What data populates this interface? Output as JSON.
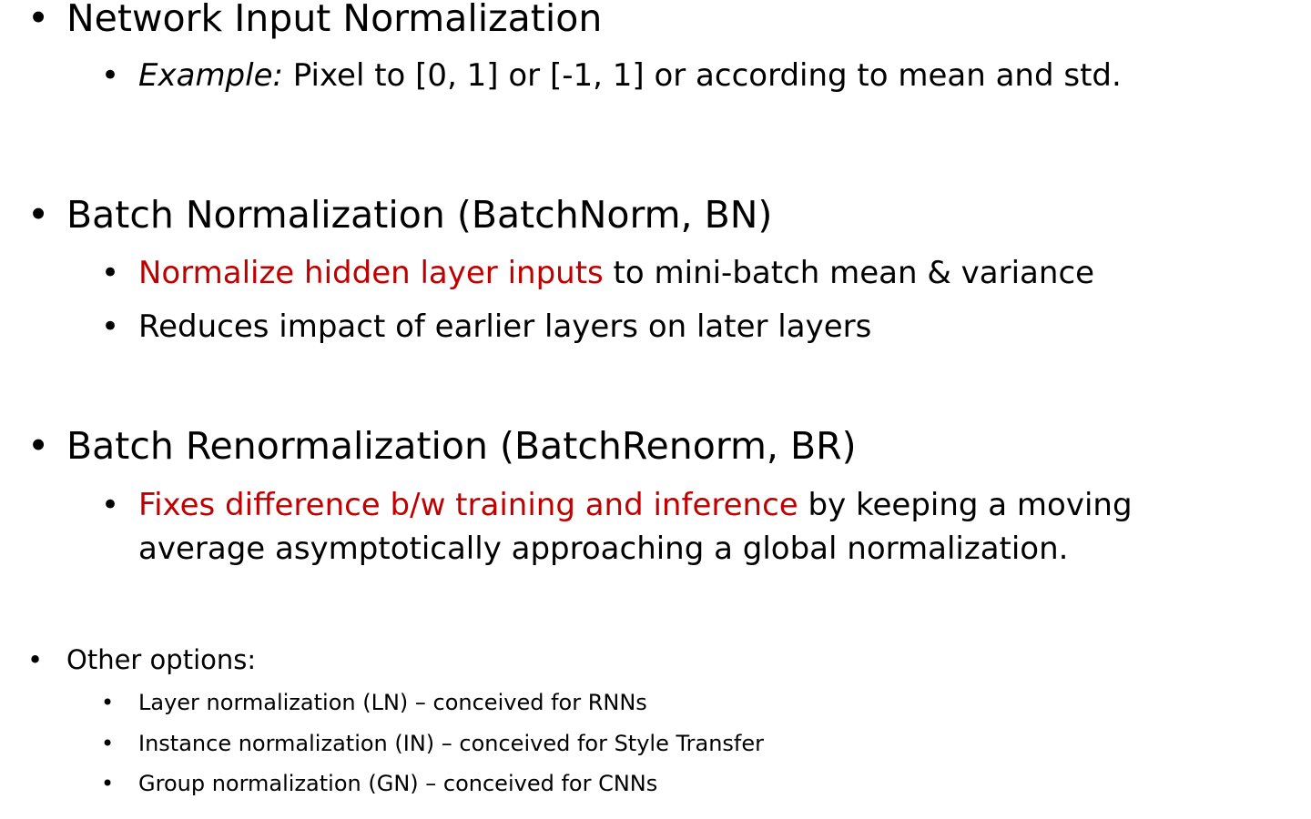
{
  "bullet_glyph": "•",
  "colors": {
    "text": "#000000",
    "highlight": "#c00000",
    "background": "#ffffff"
  },
  "section1": {
    "heading": "Network Input Normalization",
    "sub": [
      {
        "em": "Example:",
        "rest": " Pixel to [0, 1] or [-1, 1] or according to mean and std."
      }
    ]
  },
  "section2": {
    "heading": "Batch Normalization (BatchNorm, BN)",
    "sub": [
      {
        "red": "Normalize hidden layer inputs",
        "rest": " to mini-batch mean & variance"
      },
      {
        "text": "Reduces impact of earlier layers on later layers"
      }
    ]
  },
  "section3": {
    "heading": "Batch Renormalization (BatchRenorm,  BR)",
    "sub": [
      {
        "red": "Fixes difference b/w training and inference",
        "rest": " by keeping a moving",
        "continuation": "average asymptotically approaching a global normalization."
      }
    ]
  },
  "section4": {
    "heading": "Other options:",
    "sub": [
      {
        "text": "Layer normalization (LN) – conceived for RNNs"
      },
      {
        "text": "Instance normalization (IN) – conceived for Style Transfer"
      },
      {
        "text": "Group normalization (GN) – conceived for CNNs"
      }
    ]
  }
}
